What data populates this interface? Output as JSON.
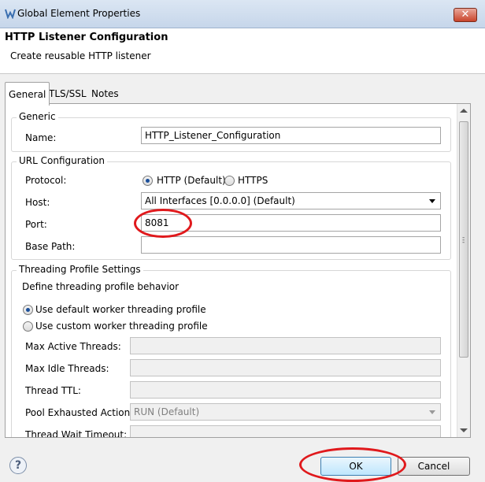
{
  "window": {
    "title": "Global Element Properties",
    "close_label": "✕"
  },
  "header": {
    "title": "HTTP Listener Configuration",
    "description": "Create reusable HTTP listener"
  },
  "tabs": [
    "General",
    "TLS/SSL",
    "Notes"
  ],
  "generic": {
    "group_label": "Generic",
    "name_label": "Name:",
    "name_value": "HTTP_Listener_Configuration"
  },
  "url_config": {
    "group_label": "URL Configuration",
    "protocol_label": "Protocol:",
    "protocol_options": [
      "HTTP (Default)",
      "HTTPS"
    ],
    "protocol_selected": "HTTP (Default)",
    "host_label": "Host:",
    "host_value": "All Interfaces [0.0.0.0] (Default)",
    "port_label": "Port:",
    "port_value": "8081",
    "base_path_label": "Base Path:",
    "base_path_value": ""
  },
  "threading": {
    "group_label": "Threading Profile Settings",
    "description": "Define threading profile behavior",
    "option_default": "Use default worker threading profile",
    "option_custom": "Use custom worker threading profile",
    "selected": "default",
    "max_active_label": "Max Active Threads:",
    "max_idle_label": "Max Idle Threads:",
    "ttl_label": "Thread TTL:",
    "pool_exhausted_label": "Pool Exhausted Action:",
    "pool_exhausted_value": "RUN (Default)",
    "wait_timeout_label": "Thread Wait Timeout:"
  },
  "buttons": {
    "ok": "OK",
    "cancel": "Cancel",
    "help": "?"
  },
  "colors": {
    "annotation": "#e0191c",
    "accent": "#1b4f9a"
  }
}
